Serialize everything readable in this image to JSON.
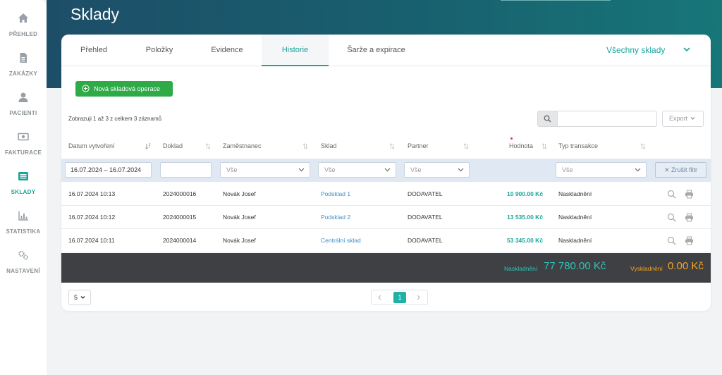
{
  "nav": [
    {
      "label": "PŘEHLED",
      "icon": "home-icon"
    },
    {
      "label": "ZAKÁZKY",
      "icon": "document-icon"
    },
    {
      "label": "PACIENTI",
      "icon": "user-icon"
    },
    {
      "label": "FAKTURACE",
      "icon": "money-icon"
    },
    {
      "label": "SKLADY",
      "icon": "list-icon",
      "active": true
    },
    {
      "label": "STATISTIKA",
      "icon": "chart-icon"
    },
    {
      "label": "NASTAVENÍ",
      "icon": "gears-icon"
    }
  ],
  "page": {
    "title": "Sklady"
  },
  "tabs": [
    "Přehled",
    "Položky",
    "Evidence",
    "Historie",
    "Šarže a expirace"
  ],
  "active_tab": "Historie",
  "warehouse_select": "Všechny sklady",
  "new_op_label": "Nová skladová operace",
  "info_text": "Zobrazuji 1 až 3 z celkem 3 záznamů",
  "export_label": "Export",
  "columns": {
    "date": "Datum vytvoření",
    "doc": "Doklad",
    "employee": "Zaměstnanec",
    "warehouse": "Sklad",
    "partner": "Partner",
    "value": "Hodnota",
    "type": "Typ transakce"
  },
  "filters": {
    "date_range": "16.07.2024 – 16.07.2024",
    "employee": "Vše",
    "warehouse": "Vše",
    "partner": "Vše",
    "type": "Vše",
    "clear_label": "✕ Zrušit filtr"
  },
  "rows": [
    {
      "date": "16.07.2024 10:13",
      "doc": "2024000016",
      "employee": "Novák Josef",
      "warehouse": "Podsklad 1",
      "partner": "DODAVATEL",
      "value": "10 900.00 Kč",
      "type": "Naskladnění"
    },
    {
      "date": "16.07.2024 10:12",
      "doc": "2024000015",
      "employee": "Novák Josef",
      "warehouse": "Podsklad 2",
      "partner": "DODAVATEL",
      "value": "13 535.00 Kč",
      "type": "Naskladnění"
    },
    {
      "date": "16.07.2024 10:11",
      "doc": "2024000014",
      "employee": "Novák Josef",
      "warehouse": "Centrální sklad",
      "partner": "DODAVATEL",
      "value": "53 345.00 Kč",
      "type": "Naskladnění"
    }
  ],
  "totals": {
    "in_label": "Naskladnění",
    "in_value": "77 780.00 Kč",
    "out_label": "Vyskladnění",
    "out_value": "0.00 Kč"
  },
  "pagination": {
    "page_size": "5",
    "current": "1"
  },
  "colors": {
    "accent": "#1aa59b",
    "green": "#2eaa47",
    "out_total": "#f5a623",
    "in_total": "#2ec4b6"
  }
}
